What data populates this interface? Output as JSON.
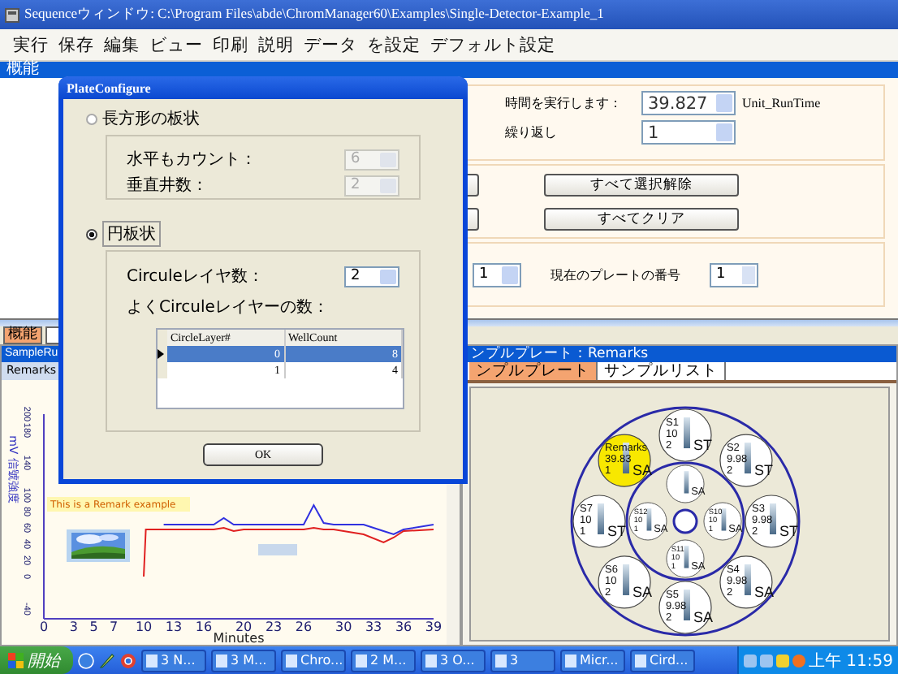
{
  "window": {
    "title": "Sequenceウィンドウ: C:\\Program Files\\abde\\ChromManager60\\Examples\\Single-Detector-Example_1"
  },
  "menu": [
    "実行",
    "保存",
    "編集",
    "ビュー",
    "印刷",
    "説明",
    "データ",
    "を設定",
    "デフォルト設定"
  ],
  "section_header": "概能",
  "run_settings": {
    "run_time_label": "時間を実行します：",
    "run_time_value": "39.827",
    "run_time_unit": "Unit_RunTime",
    "repeat_label": "繰り返し",
    "repeat_value": "1"
  },
  "action_buttons": [
    "すべて選択解除",
    "すべてクリア"
  ],
  "plate_row": {
    "select_value": "1",
    "label": "現在のプレートの番号",
    "spinner_value": "1"
  },
  "bottom_tabs": [
    {
      "label": "概能",
      "selected": true
    }
  ],
  "sample_pane": {
    "header": "SampleRu",
    "tab": "Remarks",
    "chart_data": {
      "type": "line",
      "xlabel": "Minutes",
      "ylabel": "mV 信號強度",
      "xlim": [
        0,
        39
      ],
      "ylim": [
        -52,
        200
      ],
      "xticks": [
        0,
        3,
        5,
        7,
        10,
        13,
        16,
        20,
        23,
        26,
        30,
        33,
        36,
        39
      ],
      "yticks": [
        -40,
        0,
        20,
        40,
        60,
        80,
        100,
        140,
        180,
        200
      ],
      "x": [
        10,
        10.2,
        12,
        17,
        18,
        19,
        20,
        25,
        26,
        27,
        28,
        29,
        32,
        34,
        35,
        36,
        39
      ],
      "series": [
        {
          "color": "#3030e0",
          "values": [
            null,
            null,
            64,
            64,
            72,
            64,
            64,
            64,
            64,
            88,
            66,
            64,
            64,
            56,
            52,
            58,
            64
          ]
        },
        {
          "color": "#e02020",
          "values": [
            0,
            58,
            58,
            58,
            60,
            56,
            58,
            58,
            58,
            60,
            58,
            58,
            52,
            42,
            48,
            56,
            58
          ]
        }
      ],
      "annotations": [
        "This is a Remark example"
      ]
    }
  },
  "plate_pane": {
    "header": "ンプルプレート：Remarks",
    "tabs": [
      {
        "label": "ンプルプレート",
        "selected": true
      },
      {
        "label": "サンプルリスト",
        "selected": false
      }
    ],
    "wells": [
      {
        "kind": "outer",
        "name": "S1",
        "value": "10",
        "count": "2",
        "type": "ST",
        "selected": false
      },
      {
        "kind": "outer",
        "name": "S2",
        "value": "9.98",
        "count": "2",
        "type": "ST",
        "selected": false
      },
      {
        "kind": "outer",
        "name": "S3",
        "value": "9.98",
        "count": "2",
        "type": "ST",
        "selected": false
      },
      {
        "kind": "outer",
        "name": "S4",
        "value": "9.98",
        "count": "2",
        "type": "SA",
        "selected": false
      },
      {
        "kind": "outer",
        "name": "S5",
        "value": "9.98",
        "count": "2",
        "type": "SA",
        "selected": false
      },
      {
        "kind": "outer",
        "name": "S6",
        "value": "10",
        "count": "2",
        "type": "SA",
        "selected": false
      },
      {
        "kind": "outer",
        "name": "S7",
        "value": "10",
        "count": "1",
        "type": "ST",
        "selected": false
      },
      {
        "kind": "outer",
        "name": "Remarks",
        "value": "39.83",
        "count": "1",
        "type": "SA",
        "selected": true
      },
      {
        "kind": "inner",
        "type": "SA",
        "selected": false
      },
      {
        "kind": "inner",
        "name": "S10",
        "value": "10",
        "count": "1",
        "type": "SA",
        "selected": false
      },
      {
        "kind": "inner",
        "name": "S11",
        "value": "10",
        "count": "1",
        "type": "SA",
        "selected": false
      },
      {
        "kind": "inner",
        "name": "S12",
        "value": "10",
        "count": "1",
        "type": "SA",
        "selected": false
      }
    ]
  },
  "dialog": {
    "title": "PlateConfigure",
    "rect_option": {
      "label": "長方形の板状",
      "selected": false
    },
    "rect_group": {
      "disabled": true,
      "horizontal_label": "水平もカウント：",
      "horizontal_value": "6",
      "vertical_label": "垂直井数：",
      "vertical_value": "2"
    },
    "circle_option": {
      "label": "円板状",
      "selected": true
    },
    "circle_group": {
      "layers_label": "Circuleレイヤ数：",
      "layers_value": "2",
      "wells_label": "よくCirculeレイヤーの数：",
      "columns": [
        "CircleLayer#",
        "WellCount"
      ],
      "rows": [
        {
          "cells": [
            "0",
            "8"
          ],
          "selected": true
        },
        {
          "cells": [
            "1",
            "4"
          ],
          "selected": false
        }
      ]
    },
    "ok_button": "OK"
  },
  "taskbar": {
    "start": "開始",
    "tasks": [
      "3 N...",
      "3 M...",
      "Chro...",
      "2 M...",
      "3 O...",
      "3",
      "Micr...",
      "Cird..."
    ],
    "clock": "上午 11:59"
  }
}
